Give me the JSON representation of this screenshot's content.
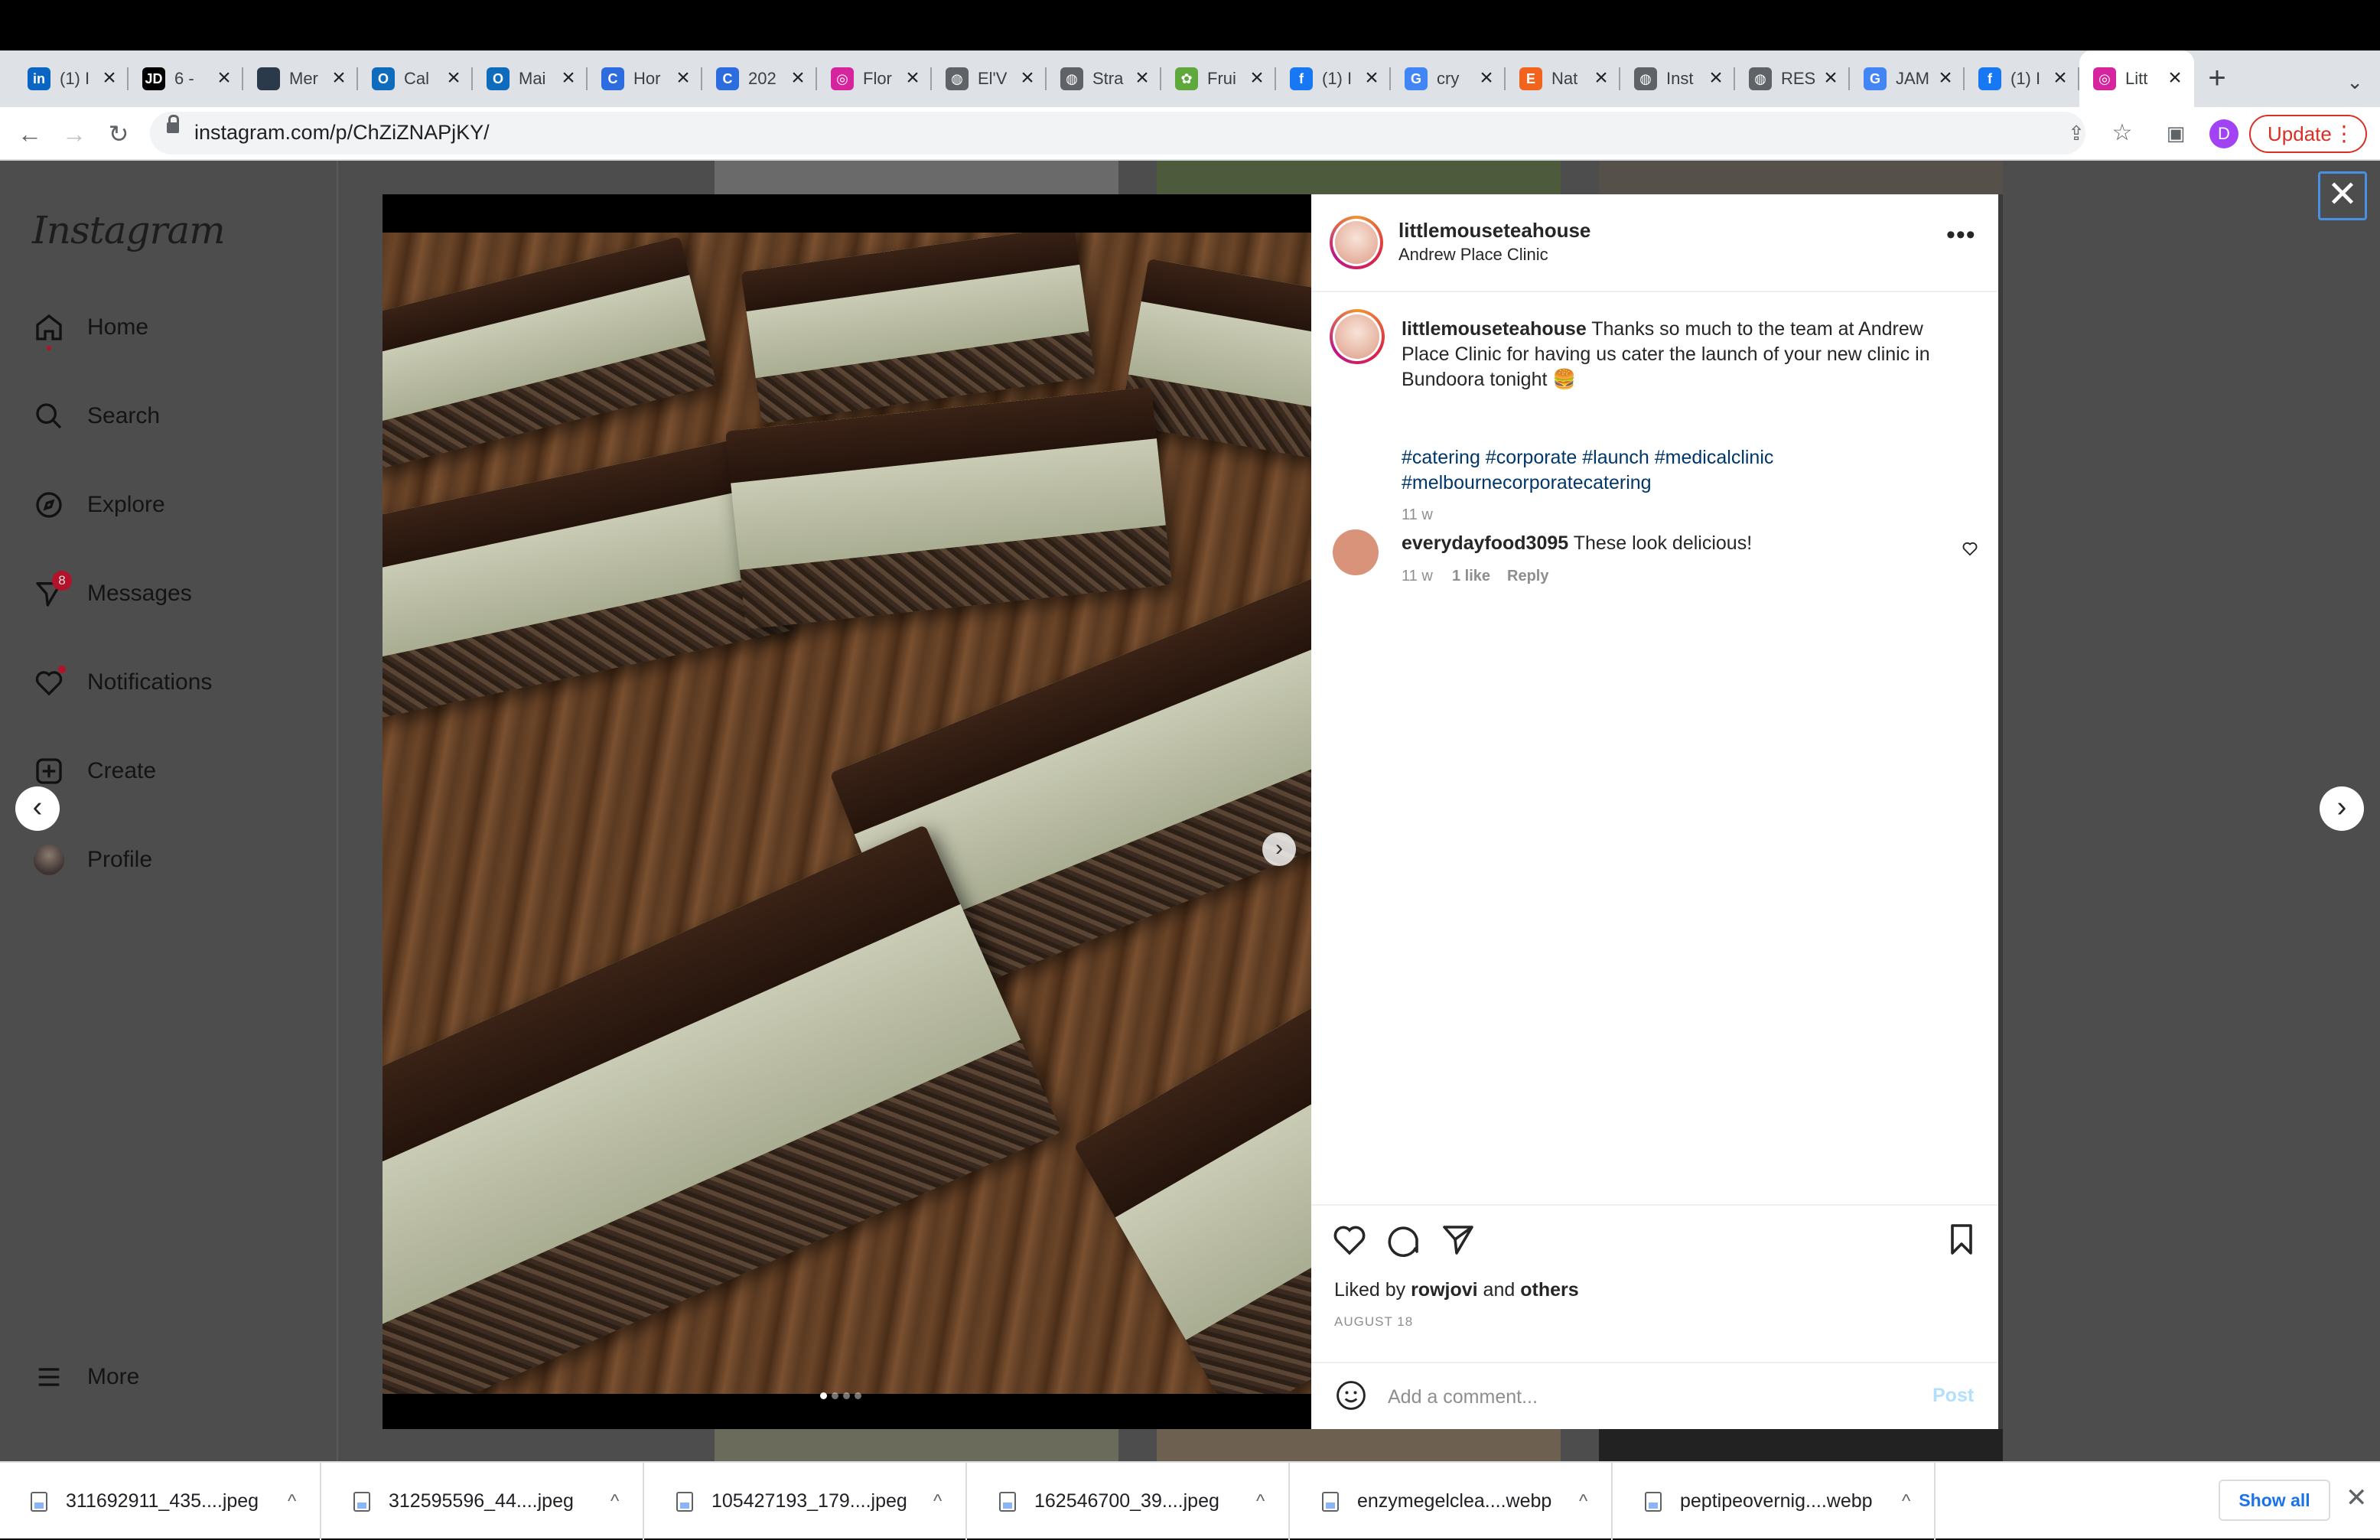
{
  "browser": {
    "tabs": [
      {
        "title": "(1) I",
        "icon": "linkedin-icon",
        "color": "#0a66c2",
        "glyph": "in"
      },
      {
        "title": "6 -",
        "icon": "jd-icon",
        "color": "#000000",
        "glyph": "JD"
      },
      {
        "title": "Mer",
        "icon": "dark-square-icon",
        "color": "#2b3a4a",
        "glyph": ""
      },
      {
        "title": "Cal",
        "icon": "outlook-icon",
        "color": "#0f6cbd",
        "glyph": "O"
      },
      {
        "title": "Mai",
        "icon": "outlook-icon",
        "color": "#0f6cbd",
        "glyph": "O"
      },
      {
        "title": "Hor",
        "icon": "c-logo-icon",
        "color": "#2d6cdf",
        "glyph": "C"
      },
      {
        "title": "202",
        "icon": "c-logo-icon",
        "color": "#2d6cdf",
        "glyph": "C"
      },
      {
        "title": "Flor",
        "icon": "instagram-icon",
        "color": "#d6249f",
        "glyph": "◎"
      },
      {
        "title": "El'V",
        "icon": "globe-icon",
        "color": "#5f6368",
        "glyph": "◍"
      },
      {
        "title": "Stra",
        "icon": "globe-icon",
        "color": "#5f6368",
        "glyph": "◍"
      },
      {
        "title": "Frui",
        "icon": "fruit-icon",
        "color": "#5fa83b",
        "glyph": "✿"
      },
      {
        "title": "(1) I",
        "icon": "facebook-icon",
        "color": "#1877f2",
        "glyph": "f"
      },
      {
        "title": "cry",
        "icon": "google-icon",
        "color": "#4285f4",
        "glyph": "G"
      },
      {
        "title": "Nat",
        "icon": "etsy-icon",
        "color": "#f1641e",
        "glyph": "E"
      },
      {
        "title": "Inst",
        "icon": "globe-icon",
        "color": "#5f6368",
        "glyph": "◍"
      },
      {
        "title": "RES",
        "icon": "globe-icon",
        "color": "#5f6368",
        "glyph": "◍"
      },
      {
        "title": "JAM",
        "icon": "google-icon",
        "color": "#4285f4",
        "glyph": "G"
      },
      {
        "title": "(1) I",
        "icon": "facebook-icon",
        "color": "#1877f2",
        "glyph": "f"
      },
      {
        "title": "Litt",
        "icon": "instagram-icon",
        "color": "#d6249f",
        "glyph": "◎",
        "active": true
      }
    ],
    "new_tab": "+",
    "url": "instagram.com/p/ChZiZNAPjKY/",
    "profile_initial": "D",
    "update_label": "Update"
  },
  "instagram": {
    "logo": "Instagram",
    "nav": [
      {
        "label": "Home",
        "icon": "home-icon"
      },
      {
        "label": "Search",
        "icon": "search-icon"
      },
      {
        "label": "Explore",
        "icon": "explore-icon"
      },
      {
        "label": "Messages",
        "icon": "messages-icon",
        "badge": "8"
      },
      {
        "label": "Notifications",
        "icon": "heart-icon"
      },
      {
        "label": "Create",
        "icon": "create-icon"
      },
      {
        "label": "Profile",
        "icon": "profile-avatar"
      }
    ],
    "more_label": "More"
  },
  "post": {
    "username": "littlemouseteahouse",
    "location": "Andrew Place Clinic",
    "caption_user": "littlemouseteahouse",
    "caption_text": "Thanks so much to the team at Andrew Place Clinic for having us cater the launch of your new clinic in Bundoora tonight 🍔",
    "hashtags": "#catering #corporate #launch #medicalclinic #melbournecorporatecatering",
    "caption_age": "11 w",
    "comment": {
      "user": "everydayfood3095",
      "text": "These look delicious!",
      "age": "11 w",
      "likes": "1 like",
      "reply": "Reply"
    },
    "liked_by_prefix": "Liked by",
    "liked_by_user": "rowjovi",
    "liked_by_and": "and",
    "liked_by_others": "others",
    "date": "AUGUST 18",
    "comment_placeholder": "Add a comment...",
    "post_label": "Post",
    "carousel_count": 4,
    "carousel_index": 1
  },
  "downloads": {
    "items": [
      "311692911_435....jpeg",
      "312595596_44....jpeg",
      "105427193_179....jpeg",
      "162546700_39....jpeg",
      "enzymegelclea....webp",
      "peptipeovernig....webp"
    ],
    "show_all": "Show all"
  }
}
